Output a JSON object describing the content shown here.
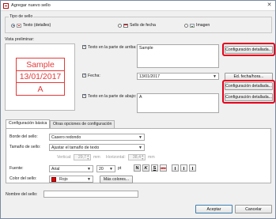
{
  "window": {
    "title": "Agregar nuevo sello",
    "close_glyph": "✕"
  },
  "stamp_type": {
    "legend": "Tipo de sello",
    "options": [
      {
        "label": "Texto (detalles)",
        "selected": true,
        "icon": "text-stamp-icon"
      },
      {
        "label": "Sello de fecha",
        "selected": false,
        "icon": "date-stamp-icon"
      },
      {
        "label": "Imagen",
        "selected": false,
        "icon": "image-stamp-icon"
      }
    ]
  },
  "preview": {
    "label": "Vista preliminar:",
    "lines": [
      "Sample",
      "13/01/2017",
      "A"
    ],
    "stamp_color": "#e53a3a"
  },
  "top_text": {
    "checkbox_label": "Texto en la parte de arriba:",
    "value": "Sample",
    "checked": true,
    "detail_button": "Configuración detallada..."
  },
  "date": {
    "checkbox_label": "Fecha:",
    "value": "13/01/2017",
    "checked": true,
    "edit_button": "Ed. fecha/hora...",
    "detail_button": "Configuración detallada..."
  },
  "bottom_text": {
    "checkbox_label": "Texto en la parte de abajo:",
    "value": "A",
    "checked": true,
    "detail_button": "Configuración detallada..."
  },
  "tabs": [
    {
      "label": "Configuración básica",
      "active": true
    },
    {
      "label": "Otras opciones de configuración",
      "active": false
    }
  ],
  "basic": {
    "border_label": "Borde del sello:",
    "border_value": "Casero redondo",
    "size_label": "Tamaño de sello:",
    "size_value": "Ajustar el tamaño de texto",
    "vertical_label": "Vertical:",
    "vertical_value": "29,7",
    "horizontal_label": "Horizontal:",
    "horizontal_value": "38,4",
    "unit": "mm",
    "font_label": "Fuente:",
    "font_value": "Arial",
    "font_size": "20",
    "font_unit": "pt",
    "format_buttons": [
      "N",
      "K",
      "S",
      "abc"
    ],
    "color_label": "Color del sello:",
    "color_value": "Rojo",
    "color_hex": "#e60000",
    "more_colors_button": "Más colores..."
  },
  "stamp_name": {
    "label": "Nombre del sello:",
    "value": ""
  },
  "footer": {
    "accept_button": "Aceptar",
    "cancel_button": "Cancelar"
  },
  "highlight_color": "#e3001b"
}
